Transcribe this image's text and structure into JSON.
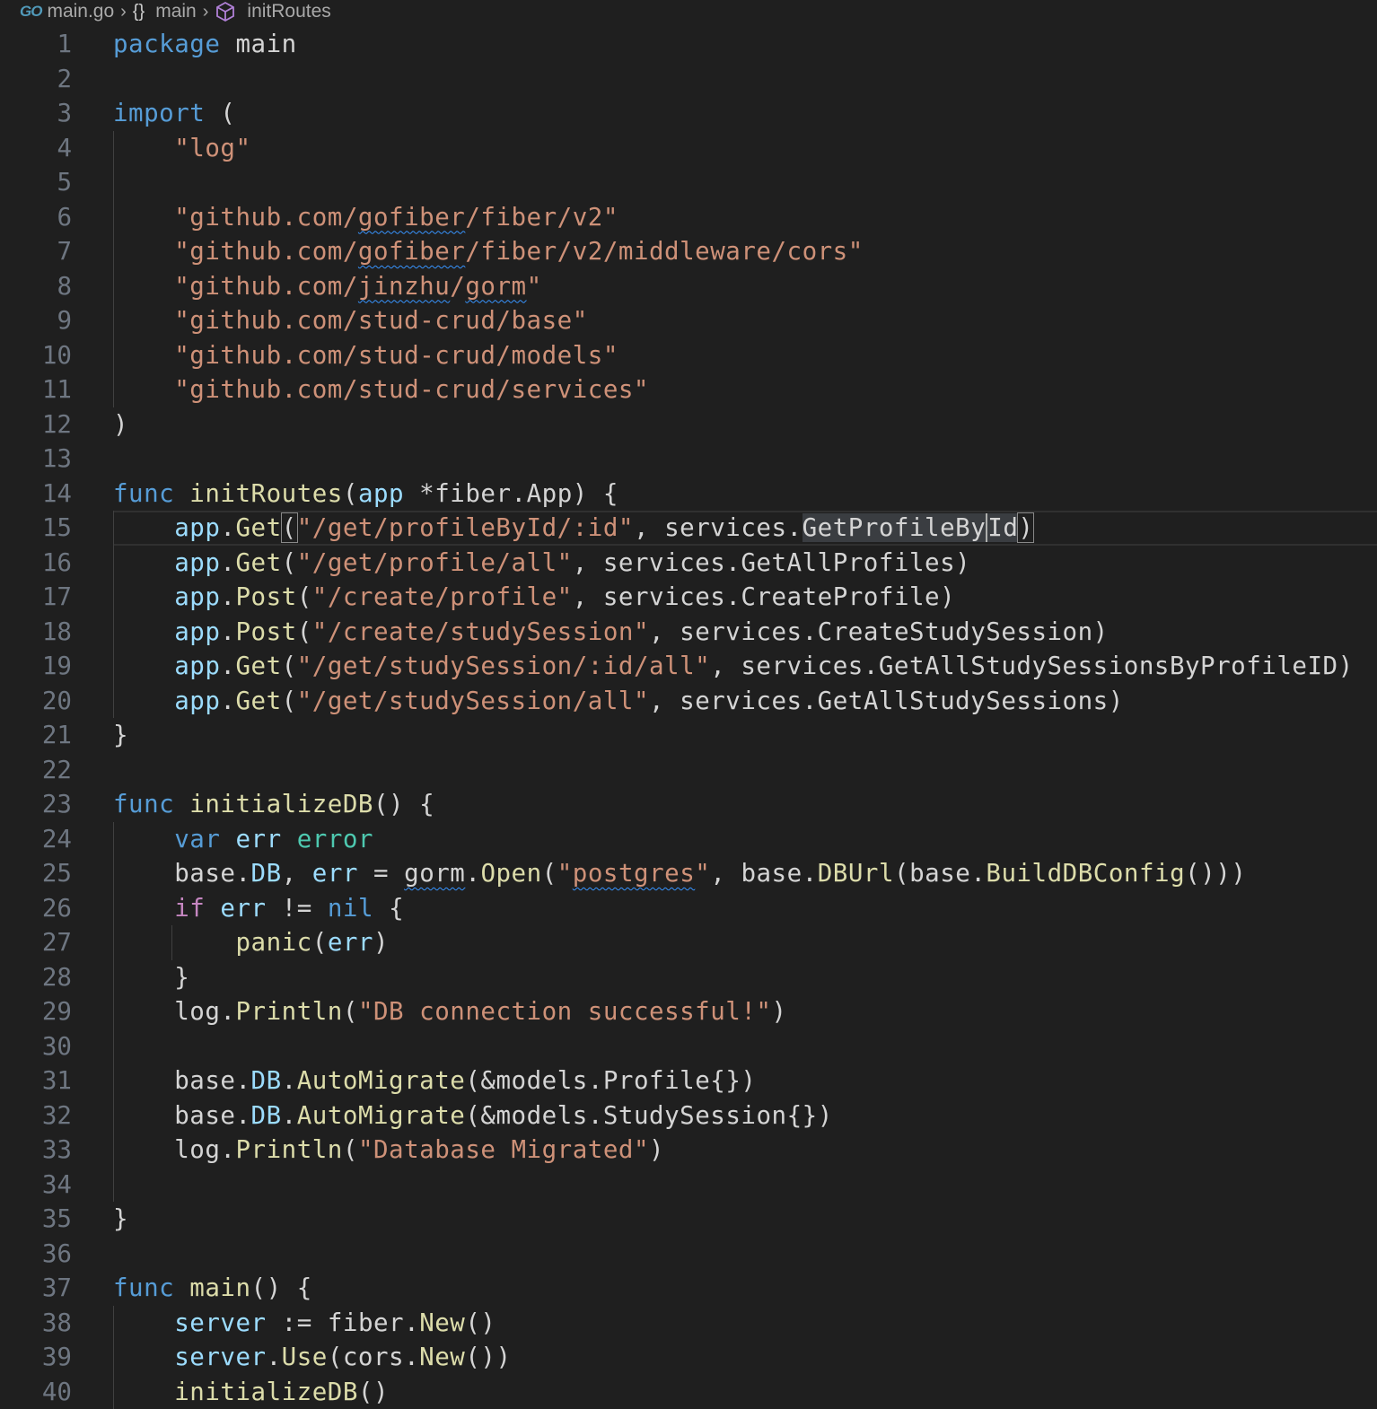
{
  "breadcrumb": {
    "file": "main.go",
    "go_logo": "GO",
    "package": "main",
    "symbol": "initRoutes",
    "icons": [
      "go-file-icon",
      "braces-icon",
      "cube-icon",
      "chevron-right-icon"
    ]
  },
  "editor": {
    "language": "go",
    "current_line": 15,
    "colors": {
      "background": "#1f1f1f",
      "keyword": "#569cd6",
      "control": "#c586c0",
      "string": "#ce9178",
      "function": "#dcdcaa",
      "type": "#4ec9b0",
      "variable": "#9cdcfe",
      "text": "#d4d4d4",
      "line_number": "#6e7681"
    },
    "lines": [
      {
        "n": "1",
        "text": "package main"
      },
      {
        "n": "2",
        "text": ""
      },
      {
        "n": "3",
        "text": "import ("
      },
      {
        "n": "4",
        "text": "    \"log\""
      },
      {
        "n": "5",
        "text": ""
      },
      {
        "n": "6",
        "text": "    \"github.com/gofiber/fiber/v2\""
      },
      {
        "n": "7",
        "text": "    \"github.com/gofiber/fiber/v2/middleware/cors\""
      },
      {
        "n": "8",
        "text": "    \"github.com/jinzhu/gorm\""
      },
      {
        "n": "9",
        "text": "    \"github.com/stud-crud/base\""
      },
      {
        "n": "10",
        "text": "    \"github.com/stud-crud/models\""
      },
      {
        "n": "11",
        "text": "    \"github.com/stud-crud/services\""
      },
      {
        "n": "12",
        "text": ")"
      },
      {
        "n": "13",
        "text": ""
      },
      {
        "n": "14",
        "text": "func initRoutes(app *fiber.App) {"
      },
      {
        "n": "15",
        "text": "    app.Get(\"/get/profileById/:id\", services.GetProfileById)"
      },
      {
        "n": "16",
        "text": "    app.Get(\"/get/profile/all\", services.GetAllProfiles)"
      },
      {
        "n": "17",
        "text": "    app.Post(\"/create/profile\", services.CreateProfile)"
      },
      {
        "n": "18",
        "text": "    app.Post(\"/create/studySession\", services.CreateStudySession)"
      },
      {
        "n": "19",
        "text": "    app.Get(\"/get/studySession/:id/all\", services.GetAllStudySessionsByProfileID)"
      },
      {
        "n": "20",
        "text": "    app.Get(\"/get/studySession/all\", services.GetAllStudySessions)"
      },
      {
        "n": "21",
        "text": "}"
      },
      {
        "n": "22",
        "text": ""
      },
      {
        "n": "23",
        "text": "func initializeDB() {"
      },
      {
        "n": "24",
        "text": "    var err error"
      },
      {
        "n": "25",
        "text": "    base.DB, err = gorm.Open(\"postgres\", base.DBUrl(base.BuildDBConfig()))"
      },
      {
        "n": "26",
        "text": "    if err != nil {"
      },
      {
        "n": "27",
        "text": "        panic(err)"
      },
      {
        "n": "28",
        "text": "    }"
      },
      {
        "n": "29",
        "text": "    log.Println(\"DB connection successful!\")"
      },
      {
        "n": "30",
        "text": ""
      },
      {
        "n": "31",
        "text": "    base.DB.AutoMigrate(&models.Profile{})"
      },
      {
        "n": "32",
        "text": "    base.DB.AutoMigrate(&models.StudySession{})"
      },
      {
        "n": "33",
        "text": "    log.Println(\"Database Migrated\")"
      },
      {
        "n": "34",
        "text": ""
      },
      {
        "n": "35",
        "text": "}"
      },
      {
        "n": "36",
        "text": ""
      },
      {
        "n": "37",
        "text": "func main() {"
      },
      {
        "n": "38",
        "text": "    server := fiber.New()"
      },
      {
        "n": "39",
        "text": "    server.Use(cors.New())"
      },
      {
        "n": "40",
        "text": "    initializeDB()"
      }
    ]
  }
}
